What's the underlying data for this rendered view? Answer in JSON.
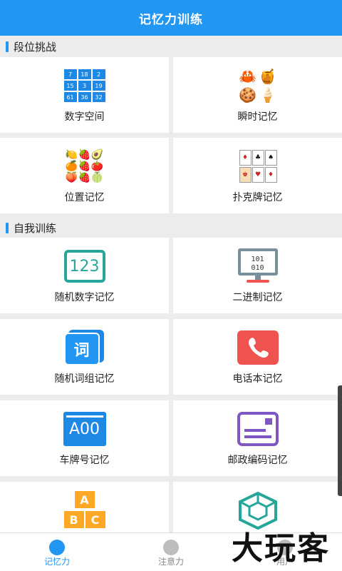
{
  "header": {
    "title": "记忆力训练"
  },
  "sections": [
    {
      "title": "段位挑战"
    },
    {
      "title": "自我训练"
    }
  ],
  "cards": {
    "number_space": {
      "label": "数字空间",
      "grid": [
        "7",
        "18",
        "2",
        "15",
        "3",
        "19",
        "61",
        "36",
        "32"
      ]
    },
    "instant_memory": {
      "label": "瞬时记忆",
      "icon": "food-icons"
    },
    "position_memory": {
      "label": "位置记忆",
      "icon": "fruit-icons"
    },
    "poker_memory": {
      "label": "扑克牌记忆",
      "icon": "playing-cards-icon"
    },
    "random_number": {
      "label": "随机数字记忆",
      "icon_text": "123"
    },
    "binary": {
      "label": "二进制记忆",
      "icon_text_1": "101",
      "icon_text_2": "010"
    },
    "random_words": {
      "label": "随机词组记忆",
      "icon_text": "词"
    },
    "phonebook": {
      "label": "电话本记忆",
      "icon": "phone-icon"
    },
    "license_plate": {
      "label": "车牌号记忆",
      "icon_text": "A00"
    },
    "postal_code": {
      "label": "邮政编码记忆",
      "icon": "envelope-icon"
    },
    "abc_blocks": {
      "letters": [
        "A",
        "B",
        "C"
      ]
    },
    "box_3d": {
      "icon": "3d-box-icon"
    }
  },
  "bottom_nav": [
    {
      "label": "记忆力",
      "active": true
    },
    {
      "label": "注意力",
      "active": false
    },
    {
      "label": "用户",
      "active": false
    }
  ],
  "watermark": "大玩客",
  "colors": {
    "primary": "#2196f3",
    "teal": "#26a69a",
    "red": "#ef5350",
    "purple": "#7e57c2",
    "orange": "#ffa726"
  }
}
